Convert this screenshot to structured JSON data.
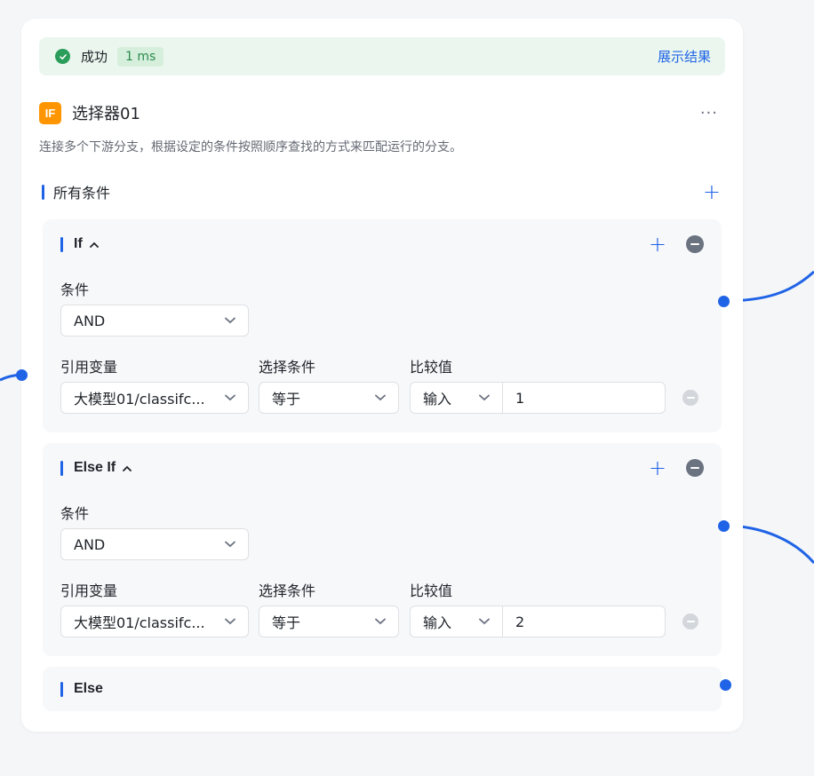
{
  "status": {
    "text": "成功",
    "time": "1 ms",
    "show_result": "展示结果"
  },
  "node": {
    "icon_text": "IF",
    "title": "选择器01",
    "more": "···",
    "description": "连接多个下游分支，根据设定的条件按照顺序查找的方式来匹配运行的分支。"
  },
  "conditions_section": {
    "title": "所有条件",
    "add": "+"
  },
  "branches": [
    {
      "name": "If",
      "condition_label": "条件",
      "logic": "AND",
      "col_var": "引用变量",
      "col_cond": "选择条件",
      "col_cmp": "比较值",
      "row": {
        "variable": "大模型01/classifc...",
        "operator": "等于",
        "value_type": "输入",
        "value": "1"
      }
    },
    {
      "name": "Else If",
      "condition_label": "条件",
      "logic": "AND",
      "col_var": "引用变量",
      "col_cond": "选择条件",
      "col_cmp": "比较值",
      "row": {
        "variable": "大模型01/classifc...",
        "operator": "等于",
        "value_type": "输入",
        "value": "2"
      }
    },
    {
      "name": "Else"
    }
  ],
  "icons": {
    "status": "check-circle-icon",
    "collapse": "chevron-up-icon",
    "dropdown": "chevron-down-icon",
    "remove": "minus-circle-icon"
  },
  "colors": {
    "accent": "#1f63e6",
    "success": "#2a9d5b",
    "node_icon": "#ff9500"
  }
}
